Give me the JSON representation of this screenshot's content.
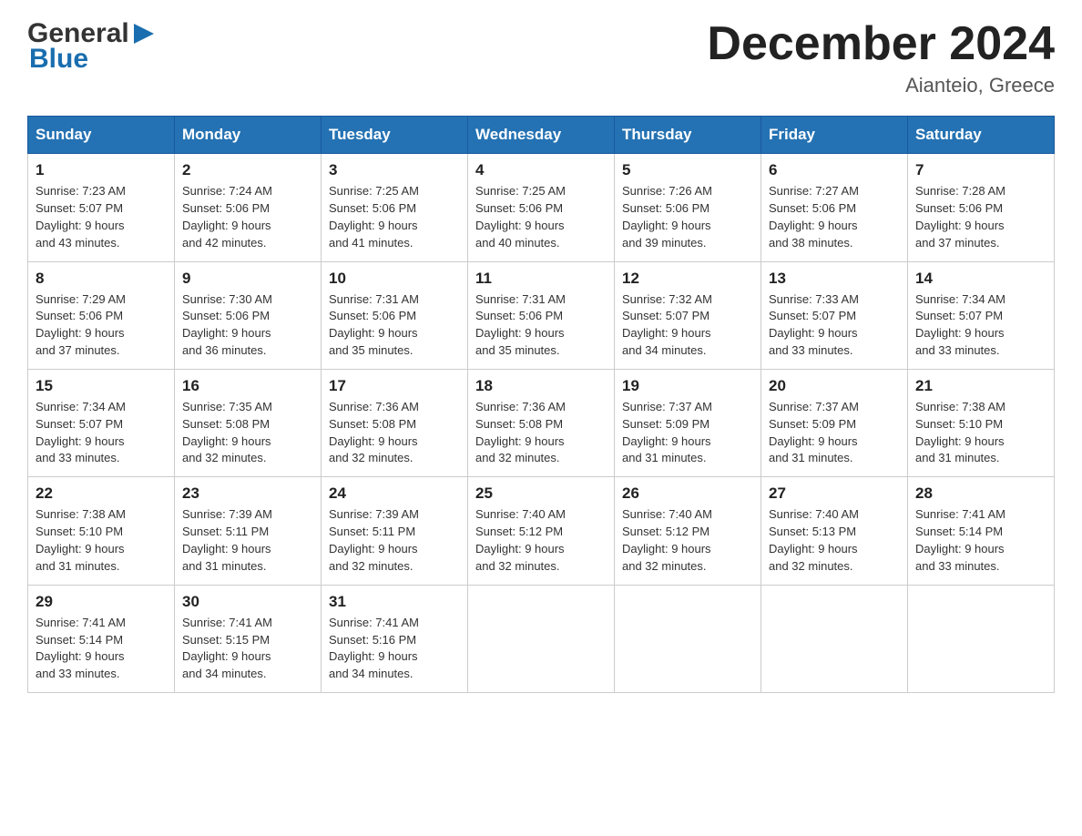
{
  "header": {
    "logo": {
      "text_general": "General",
      "text_blue": "Blue"
    },
    "title": "December 2024",
    "location": "Aianteio, Greece"
  },
  "days_of_week": [
    "Sunday",
    "Monday",
    "Tuesday",
    "Wednesday",
    "Thursday",
    "Friday",
    "Saturday"
  ],
  "weeks": [
    [
      {
        "day": "1",
        "sunrise": "7:23 AM",
        "sunset": "5:07 PM",
        "daylight": "9 hours and 43 minutes."
      },
      {
        "day": "2",
        "sunrise": "7:24 AM",
        "sunset": "5:06 PM",
        "daylight": "9 hours and 42 minutes."
      },
      {
        "day": "3",
        "sunrise": "7:25 AM",
        "sunset": "5:06 PM",
        "daylight": "9 hours and 41 minutes."
      },
      {
        "day": "4",
        "sunrise": "7:25 AM",
        "sunset": "5:06 PM",
        "daylight": "9 hours and 40 minutes."
      },
      {
        "day": "5",
        "sunrise": "7:26 AM",
        "sunset": "5:06 PM",
        "daylight": "9 hours and 39 minutes."
      },
      {
        "day": "6",
        "sunrise": "7:27 AM",
        "sunset": "5:06 PM",
        "daylight": "9 hours and 38 minutes."
      },
      {
        "day": "7",
        "sunrise": "7:28 AM",
        "sunset": "5:06 PM",
        "daylight": "9 hours and 37 minutes."
      }
    ],
    [
      {
        "day": "8",
        "sunrise": "7:29 AM",
        "sunset": "5:06 PM",
        "daylight": "9 hours and 37 minutes."
      },
      {
        "day": "9",
        "sunrise": "7:30 AM",
        "sunset": "5:06 PM",
        "daylight": "9 hours and 36 minutes."
      },
      {
        "day": "10",
        "sunrise": "7:31 AM",
        "sunset": "5:06 PM",
        "daylight": "9 hours and 35 minutes."
      },
      {
        "day": "11",
        "sunrise": "7:31 AM",
        "sunset": "5:06 PM",
        "daylight": "9 hours and 35 minutes."
      },
      {
        "day": "12",
        "sunrise": "7:32 AM",
        "sunset": "5:07 PM",
        "daylight": "9 hours and 34 minutes."
      },
      {
        "day": "13",
        "sunrise": "7:33 AM",
        "sunset": "5:07 PM",
        "daylight": "9 hours and 33 minutes."
      },
      {
        "day": "14",
        "sunrise": "7:34 AM",
        "sunset": "5:07 PM",
        "daylight": "9 hours and 33 minutes."
      }
    ],
    [
      {
        "day": "15",
        "sunrise": "7:34 AM",
        "sunset": "5:07 PM",
        "daylight": "9 hours and 33 minutes."
      },
      {
        "day": "16",
        "sunrise": "7:35 AM",
        "sunset": "5:08 PM",
        "daylight": "9 hours and 32 minutes."
      },
      {
        "day": "17",
        "sunrise": "7:36 AM",
        "sunset": "5:08 PM",
        "daylight": "9 hours and 32 minutes."
      },
      {
        "day": "18",
        "sunrise": "7:36 AM",
        "sunset": "5:08 PM",
        "daylight": "9 hours and 32 minutes."
      },
      {
        "day": "19",
        "sunrise": "7:37 AM",
        "sunset": "5:09 PM",
        "daylight": "9 hours and 31 minutes."
      },
      {
        "day": "20",
        "sunrise": "7:37 AM",
        "sunset": "5:09 PM",
        "daylight": "9 hours and 31 minutes."
      },
      {
        "day": "21",
        "sunrise": "7:38 AM",
        "sunset": "5:10 PM",
        "daylight": "9 hours and 31 minutes."
      }
    ],
    [
      {
        "day": "22",
        "sunrise": "7:38 AM",
        "sunset": "5:10 PM",
        "daylight": "9 hours and 31 minutes."
      },
      {
        "day": "23",
        "sunrise": "7:39 AM",
        "sunset": "5:11 PM",
        "daylight": "9 hours and 31 minutes."
      },
      {
        "day": "24",
        "sunrise": "7:39 AM",
        "sunset": "5:11 PM",
        "daylight": "9 hours and 32 minutes."
      },
      {
        "day": "25",
        "sunrise": "7:40 AM",
        "sunset": "5:12 PM",
        "daylight": "9 hours and 32 minutes."
      },
      {
        "day": "26",
        "sunrise": "7:40 AM",
        "sunset": "5:12 PM",
        "daylight": "9 hours and 32 minutes."
      },
      {
        "day": "27",
        "sunrise": "7:40 AM",
        "sunset": "5:13 PM",
        "daylight": "9 hours and 32 minutes."
      },
      {
        "day": "28",
        "sunrise": "7:41 AM",
        "sunset": "5:14 PM",
        "daylight": "9 hours and 33 minutes."
      }
    ],
    [
      {
        "day": "29",
        "sunrise": "7:41 AM",
        "sunset": "5:14 PM",
        "daylight": "9 hours and 33 minutes."
      },
      {
        "day": "30",
        "sunrise": "7:41 AM",
        "sunset": "5:15 PM",
        "daylight": "9 hours and 34 minutes."
      },
      {
        "day": "31",
        "sunrise": "7:41 AM",
        "sunset": "5:16 PM",
        "daylight": "9 hours and 34 minutes."
      },
      null,
      null,
      null,
      null
    ]
  ],
  "labels": {
    "sunrise": "Sunrise: ",
    "sunset": "Sunset: ",
    "daylight": "Daylight: "
  }
}
